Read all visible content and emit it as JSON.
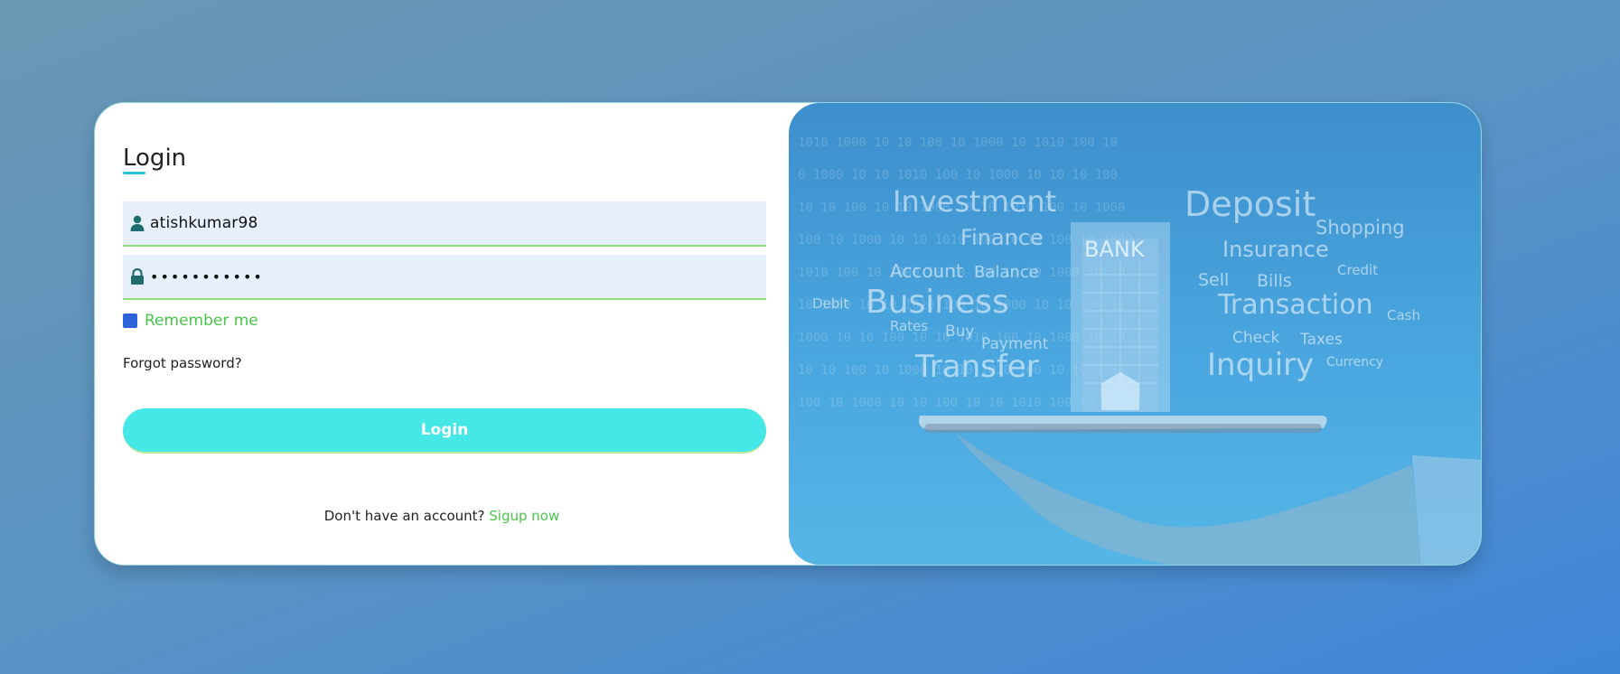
{
  "login": {
    "title": "Login",
    "username_value": "atishkumar98",
    "password_value": "•••••••••••",
    "remember_label": "Remember me",
    "forgot_label": "Forgot password?",
    "button_label": "Login",
    "signup_prompt": "Don't have an account? ",
    "signup_link": "Sigup now"
  },
  "icons": {
    "username": "user-icon",
    "password": "lock-icon"
  },
  "colors": {
    "accent_cyan": "#45e8e6",
    "accent_green": "#4ac54a",
    "checkbox_blue": "#2d63d6",
    "field_bg": "#e8effc"
  },
  "image": {
    "building_sign": "BANK",
    "words": [
      "Investment",
      "Deposit",
      "Finance",
      "Shopping",
      "Insurance",
      "Account",
      "Balance",
      "Credit",
      "Sell",
      "Bills",
      "Debit",
      "Business",
      "Transaction",
      "Cash",
      "Rates",
      "Buy",
      "Payment",
      "Check",
      "Taxes",
      "Transfer",
      "Inquiry",
      "Currency"
    ]
  }
}
